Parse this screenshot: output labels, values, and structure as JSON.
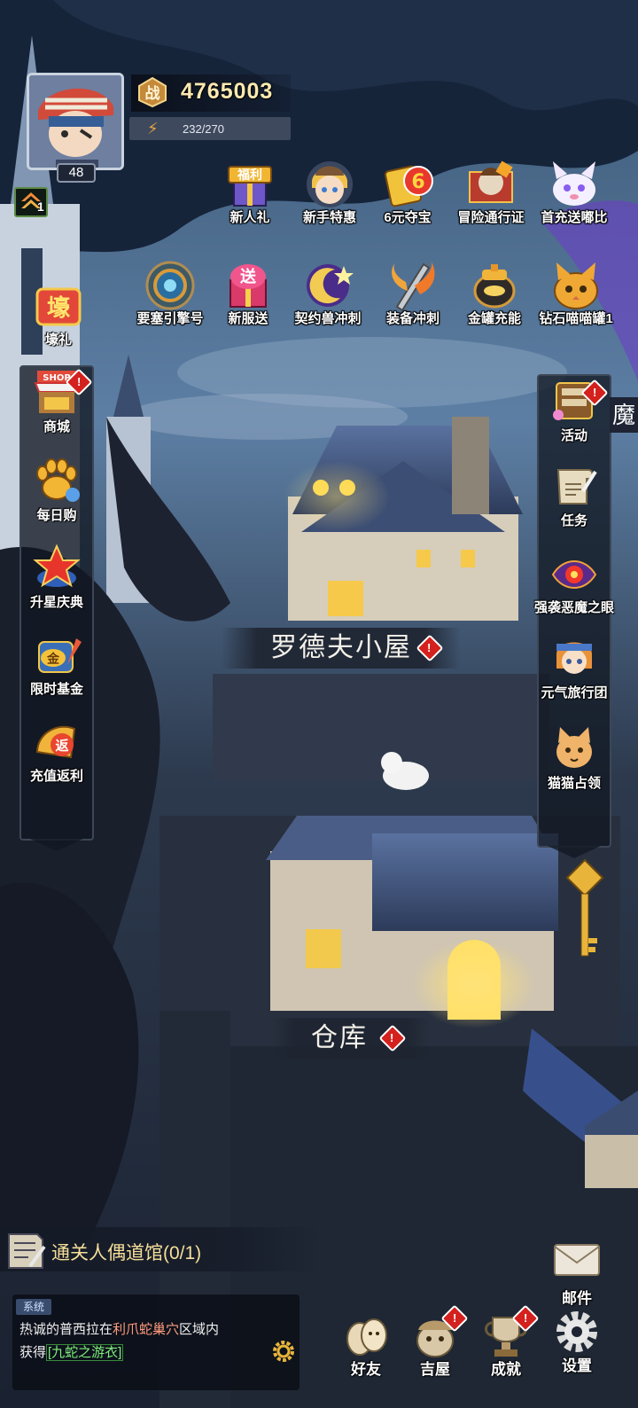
{
  "player": {
    "level": "48",
    "power": "4765003",
    "energy": "232/270",
    "rank_level": "1",
    "power_glyph": "战"
  },
  "events_row1": [
    {
      "label": "新人礼",
      "icon": "gift-box-icon",
      "badge_text": "福利"
    },
    {
      "label": "新手特惠",
      "icon": "girl-avatar-icon"
    },
    {
      "label": "6元夺宝",
      "icon": "treasure-ticket-icon",
      "badge_text": "6"
    },
    {
      "label": "冒险通行证",
      "icon": "adventure-pass-icon"
    },
    {
      "label": "首充送嘟比",
      "icon": "pet-dubi-icon"
    }
  ],
  "events_row2": [
    {
      "label": "要塞引擎号",
      "icon": "engine-icon"
    },
    {
      "label": "新服送",
      "icon": "new-server-gift-icon",
      "badge_text": "送"
    },
    {
      "label": "契约兽冲刺",
      "icon": "moon-beast-icon"
    },
    {
      "label": "装备冲刺",
      "icon": "weapon-sprint-icon"
    },
    {
      "label": "金罐充能",
      "icon": "gold-jar-icon"
    },
    {
      "label": "钻石喵喵罐1",
      "icon": "diamond-cat-jar-icon"
    }
  ],
  "left_menu": [
    {
      "label": "壕礼",
      "icon": "luxury-gift-icon",
      "badge_text": "壕"
    },
    {
      "label": "商城",
      "icon": "shop-icon",
      "badge_text": "SHOP",
      "alert": "!"
    },
    {
      "label": "每日购",
      "icon": "paw-icon"
    },
    {
      "label": "升星庆典",
      "icon": "star-icon"
    },
    {
      "label": "限时基金",
      "icon": "fund-icon",
      "badge_text": "金"
    },
    {
      "label": "充值返利",
      "icon": "rebate-icon",
      "badge_text": "返"
    }
  ],
  "right_menu": [
    {
      "label": "活动",
      "icon": "activity-icon",
      "alert": "!"
    },
    {
      "label": "任务",
      "icon": "quest-scroll-icon"
    },
    {
      "label": "强袭恶魔之眼",
      "icon": "demon-eye-icon"
    },
    {
      "label": "元气旅行团",
      "icon": "travel-girl-icon"
    },
    {
      "label": "猫猫占领",
      "icon": "cat-face-icon"
    }
  ],
  "right_edge_text": "魔",
  "buildings": [
    {
      "name": "罗德夫小屋",
      "alert": "!"
    },
    {
      "name": "仓库",
      "alert": "!"
    }
  ],
  "quest": {
    "text": "通关人偶道馆(0/1)"
  },
  "chat": {
    "tag": "系统",
    "line1_pre": "热诚的普西拉在",
    "line1_place": "利爪蛇巢穴",
    "line1_post": "区域内",
    "line2_pre": "获得",
    "line2_item": "[九蛇之游衣]"
  },
  "mail": {
    "label": "邮件"
  },
  "bottom_nav": [
    {
      "label": "好友",
      "icon": "friends-icon",
      "alert": ""
    },
    {
      "label": "吉屋",
      "icon": "house-npc-icon",
      "alert": "!"
    },
    {
      "label": "成就",
      "icon": "trophy-icon",
      "alert": "!"
    },
    {
      "label": "设置",
      "icon": "gear-icon",
      "alert": ""
    }
  ],
  "colors": {
    "power_text": "#fbe9b0",
    "alert_red": "#d4211d",
    "quest_text": "#f6df9b",
    "chat_place": "#ff9b7c",
    "chat_item": "#7ff07b"
  }
}
